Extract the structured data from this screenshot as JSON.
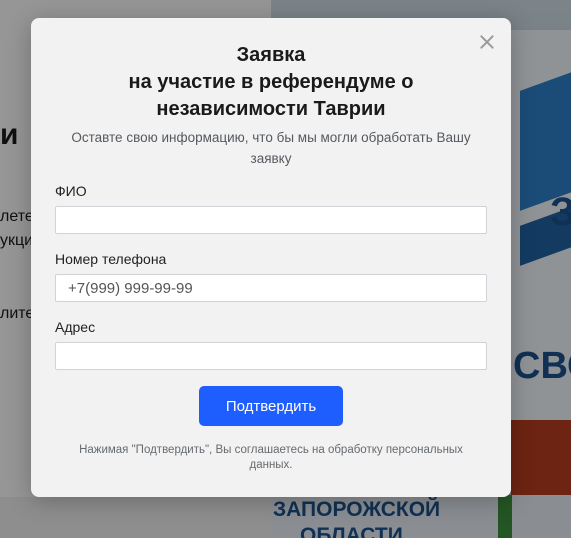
{
  "background": {
    "left_heading_fragment": "и",
    "left_text_line1": "лете",
    "left_text_line2": "укци",
    "left_text_line3": "лите",
    "right_letter_top": "З",
    "right_word_mid": "СВО",
    "bottom_line1": "ЗАПОРОЖСКОЙ",
    "bottom_line2": "ОБЛАСТИ"
  },
  "modal": {
    "title_line1": "Заявка",
    "title_line2": "на участие в референдуме о",
    "title_line3": "независимости Таврии",
    "subtitle": "Оставте свою информацию, что бы мы могли обработать Вашу заявку",
    "fields": [
      {
        "label": "ФИО",
        "value": "",
        "placeholder": ""
      },
      {
        "label": "Номер телефона",
        "value": "",
        "placeholder": "+7(999) 999-99-99"
      },
      {
        "label": "Адрес",
        "value": "",
        "placeholder": ""
      }
    ],
    "submit_label": "Подтвердить",
    "consent_text": "Нажимая \"Подтвердить\", Вы соглашаетесь на обработку персональных данных."
  },
  "colors": {
    "accent": "#1e5eff",
    "modal_bg": "#f2f2f2"
  },
  "icons": {
    "close": "close-icon"
  }
}
